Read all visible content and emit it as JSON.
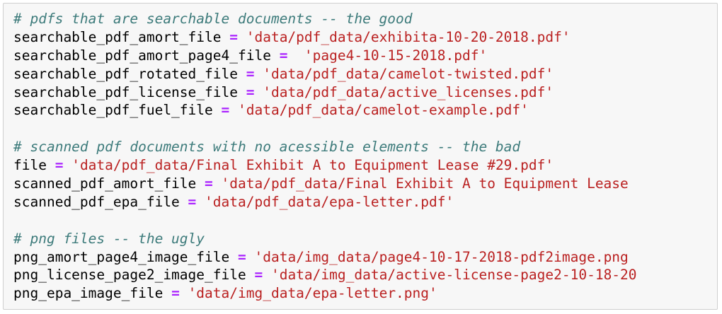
{
  "code_cell": {
    "lines": [
      {
        "type": "comment",
        "text": "# pdfs that are searchable documents -- the good"
      },
      {
        "type": "assign",
        "var": "searchable_pdf_amort_file",
        "op": " = ",
        "value": "'data/pdf_data/exhibita-10-20-2018.pdf'"
      },
      {
        "type": "assign",
        "var": "searchable_pdf_amort_page4_file",
        "op": " =  ",
        "value": "'page4-10-15-2018.pdf'"
      },
      {
        "type": "assign",
        "var": "searchable_pdf_rotated_file",
        "op": " = ",
        "value": "'data/pdf_data/camelot-twisted.pdf'"
      },
      {
        "type": "assign",
        "var": "searchable_pdf_license_file",
        "op": " = ",
        "value": "'data/pdf_data/active_licenses.pdf'"
      },
      {
        "type": "assign",
        "var": "searchable_pdf_fuel_file",
        "op": " = ",
        "value": "'data/pdf_data/camelot-example.pdf'"
      },
      {
        "type": "blank"
      },
      {
        "type": "comment",
        "text": "# scanned pdf documents with no acessible elements -- the bad"
      },
      {
        "type": "assign",
        "var": "file",
        "op": " = ",
        "value": "'data/pdf_data/Final Exhibit A to Equipment Lease #29.pdf'"
      },
      {
        "type": "assign",
        "var": "scanned_pdf_amort_file",
        "op": " = ",
        "value": "'data/pdf_data/Final Exhibit A to Equipment Lease"
      },
      {
        "type": "assign",
        "var": "scanned_pdf_epa_file",
        "op": " = ",
        "value": "'data/pdf_data/epa-letter.pdf'"
      },
      {
        "type": "blank"
      },
      {
        "type": "comment",
        "text": "# png files -- the ugly"
      },
      {
        "type": "assign",
        "var": "png_amort_page4_image_file",
        "op": " = ",
        "value": "'data/img_data/page4-10-17-2018-pdf2image.png"
      },
      {
        "type": "assign",
        "var": "png_license_page2_image_file",
        "op": " = ",
        "value": "'data/img_data/active-license-page2-10-18-20"
      },
      {
        "type": "assign",
        "var": "png_epa_image_file",
        "op": " = ",
        "value": "'data/img_data/epa-letter.png'"
      }
    ]
  },
  "colors": {
    "background": "#f7f7f7",
    "border": "#cfcfcf",
    "comment": "#3d7b7b",
    "operator": "#aa22ff",
    "string": "#ba2121"
  }
}
